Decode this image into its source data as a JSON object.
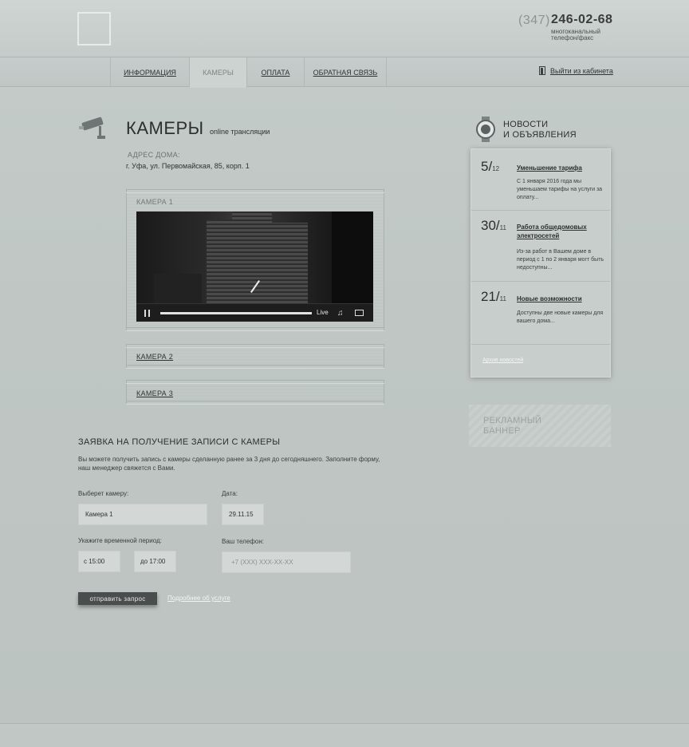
{
  "header": {
    "phone_code": "(347)",
    "phone_number": "246-02-68",
    "phone_note": "многоканальный телефон/факс"
  },
  "nav": {
    "items": [
      {
        "label": "ИНФОРМАЦИЯ"
      },
      {
        "label": "КАМЕРЫ"
      },
      {
        "label": "ОПЛАТА"
      },
      {
        "label": "ОБРАТНАЯ СВЯЗЬ"
      }
    ],
    "logout_label": "Выйти из кабинета"
  },
  "page": {
    "title": "КАМЕРЫ",
    "subtitle": "online трансляции",
    "address_label": "АДРЕС ДОМА:",
    "address_value": "г. Уфа, ул. Первомайская, 85, корп. 1"
  },
  "cameras": [
    {
      "label": "КАМЕРА 1"
    },
    {
      "label": "КАМЕРА 2"
    },
    {
      "label": "КАМЕРА 3"
    }
  ],
  "player": {
    "live_label": "Live",
    "icons": [
      "pause-icon",
      "volume-icon",
      "screen-icon"
    ]
  },
  "request": {
    "title": "ЗАЯВКА НА ПОЛУЧЕНИЕ ЗАПИСИ С КАМЕРЫ",
    "description": "Вы можете получить запись с камеры сделанную ранее за 3 дня до сегодняшнего. Заполните форму, наш менеджер свяжется с Вами.",
    "camera_label": "Выберет камеру:",
    "camera_value": "Камера 1",
    "date_label": "Дата:",
    "date_value": "29.11.15",
    "period_label": "Укажите временной период:",
    "from_value": "с 15:00",
    "to_value": "до 17:00",
    "phone_label": "Ваш телефон:",
    "phone_placeholder": "+7 (XXX) XXX-XX-XX",
    "submit_label": "отправить запрос",
    "more_link": "Подробнее об услуге"
  },
  "news": {
    "title_line1": "НОВОСТИ",
    "title_line2": "И ОБЪЯВЛЕНИЯ",
    "items": [
      {
        "day": "5/",
        "month": "12",
        "headline": "Уменьшение тарифа",
        "text": "С 1 января 2016 года мы уменьшаем тарифы на услуги за оплату..."
      },
      {
        "day": "30/",
        "month": "11",
        "headline": "Работа общедомовых электросетей",
        "text": "Из-за работ в Вашем доме в период с 1 по 2 января могт быть недоступны..."
      },
      {
        "day": "21/",
        "month": "11",
        "headline": "Новые возможности",
        "text": "Доступны две новые камеры для вашего дома..."
      }
    ],
    "archive_link": "Архив новостей"
  },
  "banner": {
    "line1": "РЕКЛАМНЫЙ",
    "line2": "БАННЕР"
  }
}
